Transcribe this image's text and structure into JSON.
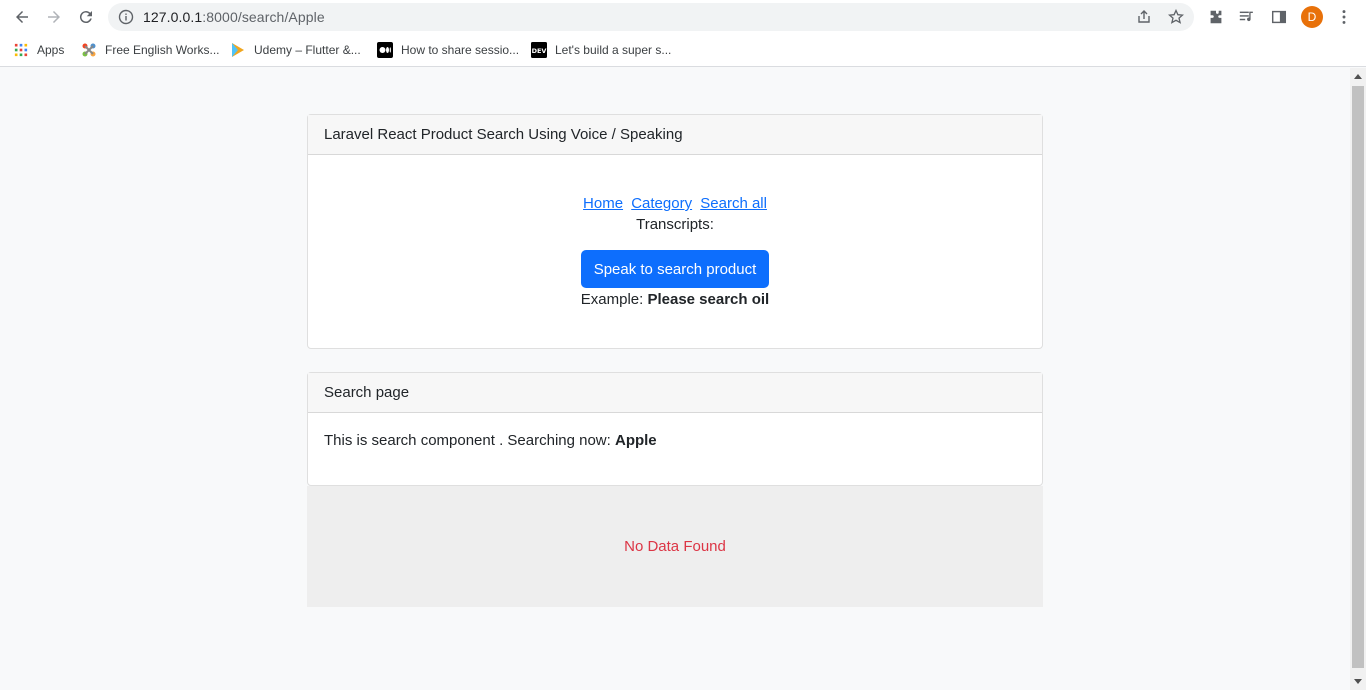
{
  "browser": {
    "url_host": "127.0.0.1",
    "url_path": ":8000/search/Apple",
    "avatar_letter": "D",
    "avatar_color": "#e8710a"
  },
  "bookmarks": [
    {
      "label": "Apps",
      "icon": "apps-grid-icon"
    },
    {
      "label": "Free English Works...",
      "icon": "joomla-icon"
    },
    {
      "label": "Udemy – Flutter &...",
      "icon": "udemy-icon"
    },
    {
      "label": "How to share sessio...",
      "icon": "medium-icon"
    },
    {
      "label": "Let's build a super s...",
      "icon": "dev-icon"
    }
  ],
  "main_card": {
    "title": "Laravel React Product Search Using Voice / Speaking",
    "links": [
      "Home",
      "Category",
      "Search all"
    ],
    "transcripts_label": "Transcripts:",
    "speak_button": "Speak to search product",
    "example_label": "Example:",
    "example_text": "Please search oil"
  },
  "search_card": {
    "title": "Search page",
    "text": "This is search component . Searching now:",
    "query": "Apple"
  },
  "results": {
    "empty_message": "No Data Found"
  },
  "colors": {
    "primary": "#0d6efd",
    "danger": "#dc3545"
  }
}
